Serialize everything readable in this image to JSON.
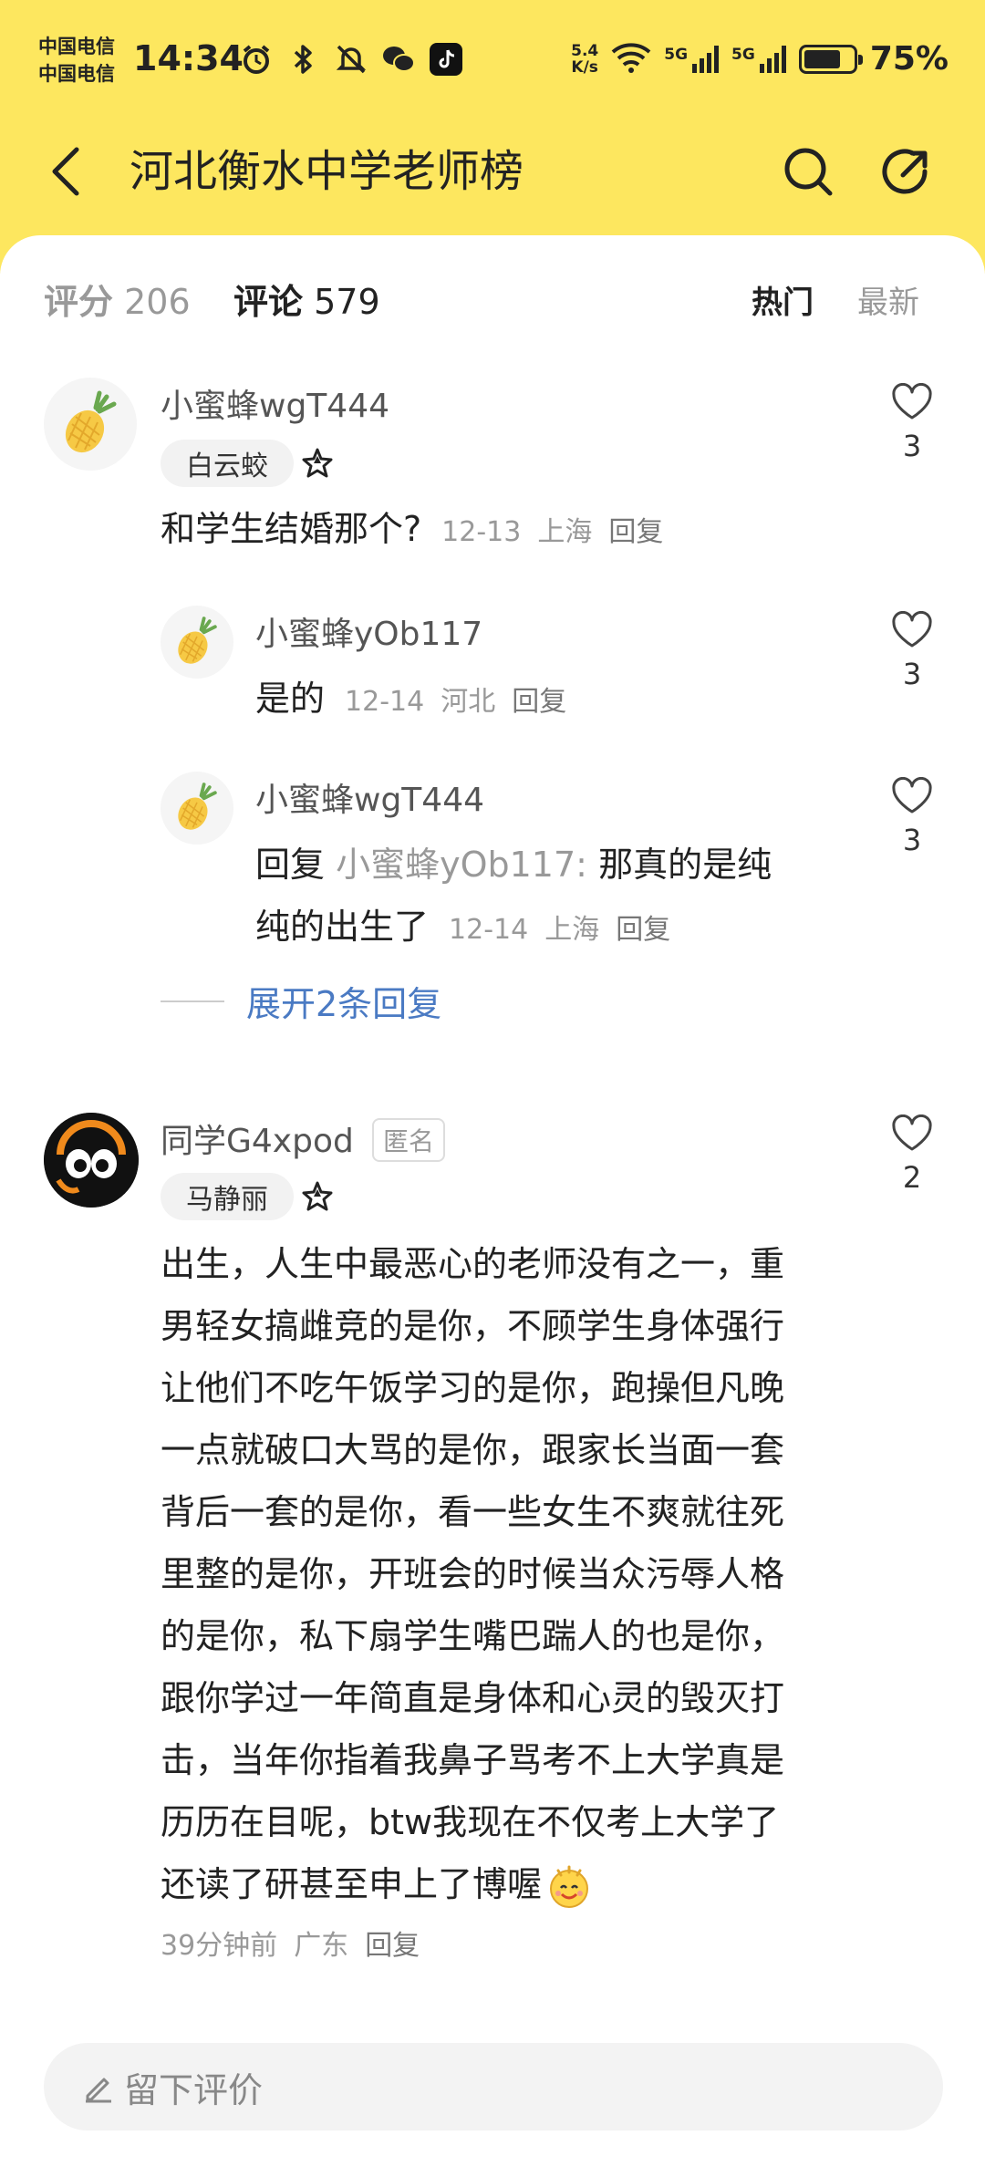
{
  "status_bar": {
    "carrier1": "中国电信",
    "carrier2": "中国电信",
    "time": "14:34",
    "speed_top": "5.4",
    "speed_bottom": "K/s",
    "net1": "5G",
    "net2": "5G",
    "battery_percent": "75%",
    "battery_level": 0.75
  },
  "nav": {
    "title": "河北衡水中学老师榜"
  },
  "stats": {
    "rating_label": "评分",
    "rating_count": "206",
    "comments_label": "评论",
    "comments_count": "579",
    "sort_hot": "热门",
    "sort_new": "最新"
  },
  "comments": [
    {
      "user": "小蜜蜂wgT444",
      "tag": "白云蛟",
      "text": "和学生结婚那个?",
      "date": "12-13",
      "location": "上海",
      "reply": "回复",
      "likes": "3",
      "replies": [
        {
          "user": "小蜜蜂yOb117",
          "text": "是的",
          "date": "12-14",
          "location": "河北",
          "reply": "回复",
          "likes": "3"
        },
        {
          "user": "小蜜蜂wgT444",
          "reply_prefix": "回复",
          "reply_to": "小蜜蜂yOb117:",
          "text_line1": "那真的是纯",
          "text_line2": "纯的出生了",
          "date": "12-14",
          "location": "上海",
          "reply": "回复",
          "likes": "3"
        }
      ],
      "expand_label": "展开2条回复"
    },
    {
      "user": "同学G4xpod",
      "anon_label": "匿名",
      "tag": "马静丽",
      "lines": [
        "出生，人生中最恶心的老师没有之一，重",
        "男轻女搞雌竞的是你，不顾学生身体强行",
        "让他们不吃午饭学习的是你，跑操但凡晚",
        "一点就破口大骂的是你，跟家长当面一套",
        "背后一套的是你，看一些女生不爽就往死",
        "里整的是你，开班会的时候当众污辱人格",
        "的是你，私下扇学生嘴巴踹人的也是你，",
        "跟你学过一年简直是身体和心灵的毁灭打",
        "击，当年你指着我鼻子骂考不上大学真是",
        "历历在目呢，btw我现在不仅考上大学了",
        "还读了研甚至申上了博喔"
      ],
      "date": "39分钟前",
      "location": "广东",
      "reply": "回复",
      "likes": "2"
    }
  ],
  "bottom": {
    "placeholder": "留下评价"
  },
  "colors": {
    "header": "#fde75f",
    "link": "#4a7ac3"
  }
}
